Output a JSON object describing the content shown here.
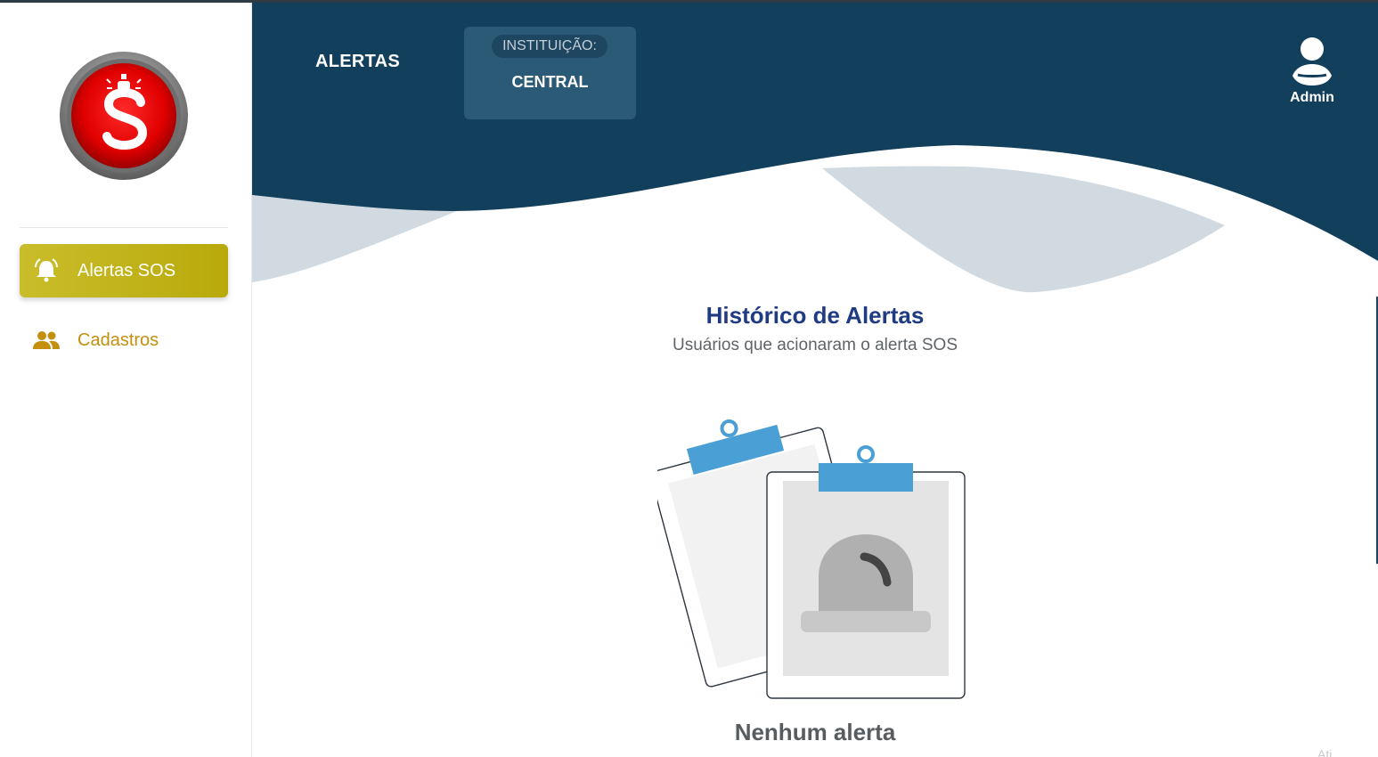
{
  "sidebar": {
    "logo_icon": "sos-siren-logo",
    "items": [
      {
        "label": "Alertas SOS",
        "icon": "alarm-bell-icon",
        "active": true
      },
      {
        "label": "Cadastros",
        "icon": "people-icon",
        "active": false
      }
    ]
  },
  "header": {
    "title": "ALERTAS",
    "institution_label": "INSTITUIÇÃO:",
    "institution_value": "CENTRAL",
    "user_label": "Admin",
    "user_icon": "user-avatar-icon"
  },
  "content": {
    "title": "Histórico de Alertas",
    "subtitle": "Usuários que acionaram o alerta SOS",
    "empty_state": "Nenhum alerta",
    "empty_illustration": "clipboard-siren-illustration",
    "corner_text": "Ati"
  },
  "colors": {
    "header_bg": "#123f5c",
    "wave_light": "#d1dae1",
    "active_nav": "#c2b31a",
    "nav_text": "#c48f0f",
    "title": "#1f3b82",
    "clip_blue": "#4a9fd4"
  }
}
